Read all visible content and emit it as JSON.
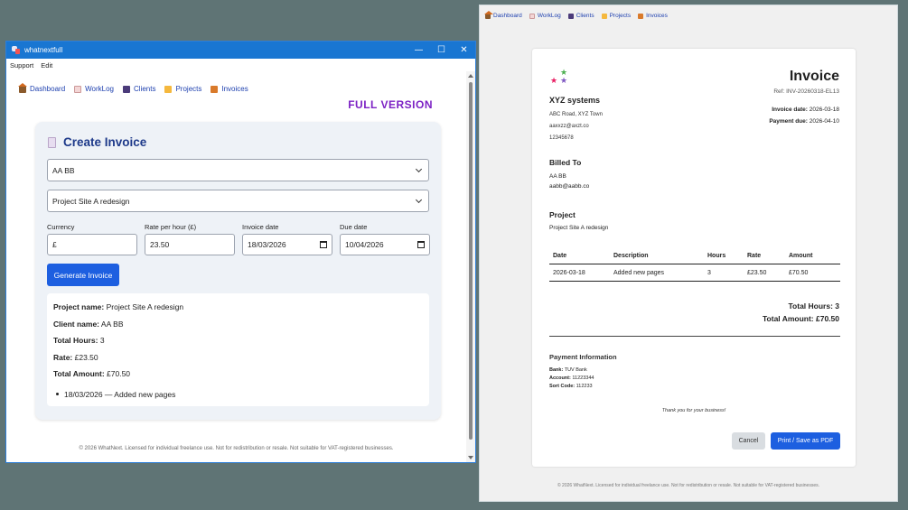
{
  "app_window": {
    "title": "whatnextfull",
    "controls": {
      "minimize": "—",
      "maximize": "☐",
      "close": "✕"
    },
    "menu": [
      "Support",
      "Edit"
    ]
  },
  "nav": {
    "items": [
      {
        "label": "Dashboard",
        "icon": "home-icon"
      },
      {
        "label": "WorkLog",
        "icon": "notebook-icon"
      },
      {
        "label": "Clients",
        "icon": "people-icon"
      },
      {
        "label": "Projects",
        "icon": "folder-icon"
      },
      {
        "label": "Invoices",
        "icon": "moneybag-icon"
      }
    ]
  },
  "banner": "FULL VERSION",
  "create_invoice": {
    "title": "Create Invoice",
    "client_select": "AA BB",
    "project_select": "Project Site A redesign",
    "fields": {
      "currency": {
        "label": "Currency",
        "value": "£"
      },
      "rate": {
        "label": "Rate per hour (£)",
        "value": "23.50"
      },
      "invoice_date": {
        "label": "Invoice date",
        "value": "18/03/2026"
      },
      "due_date": {
        "label": "Due date",
        "value": "10/04/2026"
      }
    },
    "generate_button": "Generate Invoice",
    "summary": {
      "project_label": "Project name:",
      "project_value": "Project Site A redesign",
      "client_label": "Client name:",
      "client_value": "AA BB",
      "hours_label": "Total Hours:",
      "hours_value": "3",
      "rate_label": "Rate:",
      "rate_value": "£23.50",
      "amount_label": "Total Amount:",
      "amount_value": "£70.50",
      "entries": [
        "18/03/2026 — Added new pages"
      ]
    }
  },
  "footer": "© 2026 WhatNext. Licensed for individual freelance use. Not for redistribution or resale. Not suitable for VAT-registered businesses.",
  "invoice": {
    "heading": "Invoice",
    "ref": "Ref: INV-20260318-EL13",
    "invoice_date_label": "Invoice date:",
    "invoice_date": "2026-03-18",
    "payment_due_label": "Payment due:",
    "payment_due": "2026-04-10",
    "company": {
      "name": "XYZ systems",
      "address": "ABC Road, XYZ Town",
      "email": "aaxxzz@axzt.co",
      "phone": "12345678"
    },
    "billed_to": {
      "title": "Billed To",
      "name": "AA BB",
      "email": "aabb@aabb.co"
    },
    "project": {
      "title": "Project",
      "name": "Project Site A redesign"
    },
    "table": {
      "headers": [
        "Date",
        "Description",
        "Hours",
        "Rate",
        "Amount"
      ],
      "rows": [
        [
          "2026-03-18",
          "Added new pages",
          "3",
          "£23.50",
          "£70.50"
        ]
      ]
    },
    "total_hours": "Total Hours: 3",
    "total_amount": "Total Amount: £70.50",
    "payment": {
      "title": "Payment Information",
      "bank_label": "Bank:",
      "bank": "TUV Bank",
      "account_label": "Account:",
      "account": "11223344",
      "sort_label": "Sort Code:",
      "sort": "112233"
    },
    "thanks": "Thank you for your business!",
    "cancel_button": "Cancel",
    "print_button": "Print / Save as PDF"
  }
}
